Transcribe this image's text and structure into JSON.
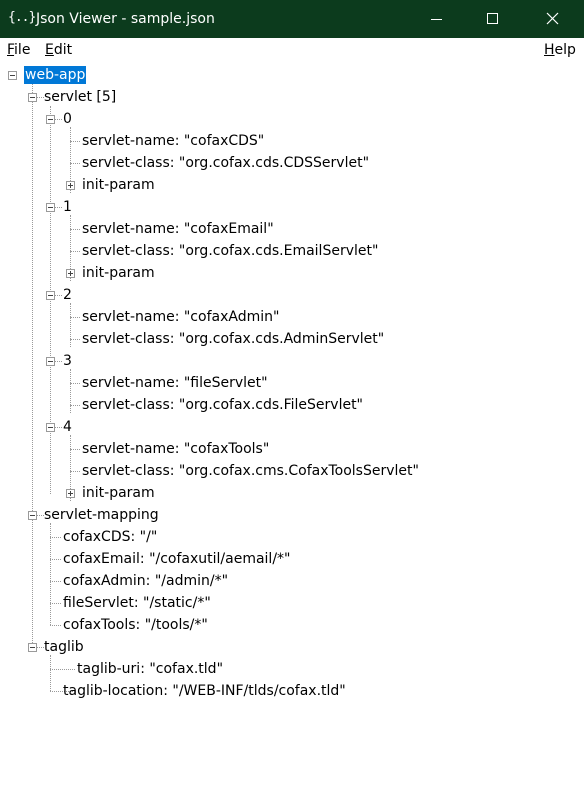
{
  "window": {
    "icon_text": "{..}",
    "title": "Json Viewer - sample.json"
  },
  "menu": {
    "file": {
      "mnemonic": "F",
      "rest": "ile"
    },
    "edit": {
      "mnemonic": "E",
      "rest": "dit"
    },
    "help": {
      "mnemonic": "H",
      "rest": "elp"
    }
  },
  "tree": {
    "root": "web-app",
    "servlet": {
      "label": "servlet [5]",
      "items": [
        {
          "index": "0",
          "name": "servlet-name: \"cofaxCDS\"",
          "class": "servlet-class: \"org.cofax.cds.CDSServlet\"",
          "init": "init-param"
        },
        {
          "index": "1",
          "name": "servlet-name: \"cofaxEmail\"",
          "class": "servlet-class: \"org.cofax.cds.EmailServlet\"",
          "init": "init-param"
        },
        {
          "index": "2",
          "name": "servlet-name: \"cofaxAdmin\"",
          "class": "servlet-class: \"org.cofax.cds.AdminServlet\""
        },
        {
          "index": "3",
          "name": "servlet-name: \"fileServlet\"",
          "class": "servlet-class: \"org.cofax.cds.FileServlet\""
        },
        {
          "index": "4",
          "name": "servlet-name: \"cofaxTools\"",
          "class": "servlet-class: \"org.cofax.cms.CofaxToolsServlet\"",
          "init": "init-param"
        }
      ]
    },
    "servlet_mapping": {
      "label": "servlet-mapping",
      "items": [
        "cofaxCDS: \"/\"",
        "cofaxEmail: \"/cofaxutil/aemail/*\"",
        "cofaxAdmin: \"/admin/*\"",
        "fileServlet: \"/static/*\"",
        "cofaxTools: \"/tools/*\""
      ]
    },
    "taglib": {
      "label": "taglib",
      "items": [
        "taglib-uri: \"cofax.tld\"",
        "taglib-location: \"/WEB-INF/tlds/cofax.tld\""
      ]
    }
  }
}
